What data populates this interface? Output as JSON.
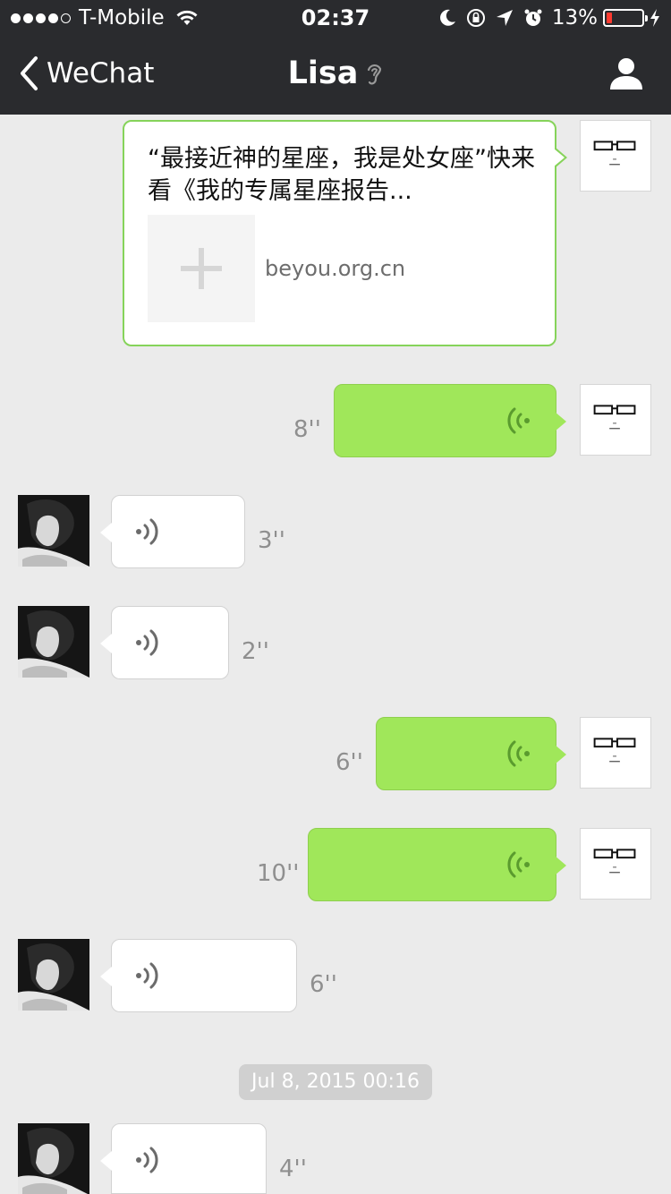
{
  "status_bar": {
    "carrier": "T-Mobile",
    "time": "02:37",
    "battery": "13%",
    "battery_level": 0.13
  },
  "nav": {
    "back_label": "WeChat",
    "title": "Lisa"
  },
  "link_card": {
    "title": "“最接近神的星座，我是处女座”快来看《我的专属星座报告...",
    "domain": "beyou.org.cn"
  },
  "messages": [
    {
      "from": "me",
      "duration": "8''"
    },
    {
      "from": "lisa",
      "duration": "3''"
    },
    {
      "from": "lisa",
      "duration": "2''"
    },
    {
      "from": "me",
      "duration": "6''"
    },
    {
      "from": "me",
      "duration": "10''"
    },
    {
      "from": "lisa",
      "duration": "6''"
    },
    {
      "from": "lisa",
      "duration": "4''"
    }
  ],
  "timestamp": "Jul 8, 2015 00:16",
  "colors": {
    "outgoing_bubble": "#a0e75a",
    "incoming_bubble": "#ffffff",
    "header_bg": "#2a2b2e",
    "chat_bg": "#ebebeb"
  },
  "icons": {
    "back": "chevron-left-icon",
    "voice_mode": "ear-icon",
    "profile": "person-icon"
  }
}
